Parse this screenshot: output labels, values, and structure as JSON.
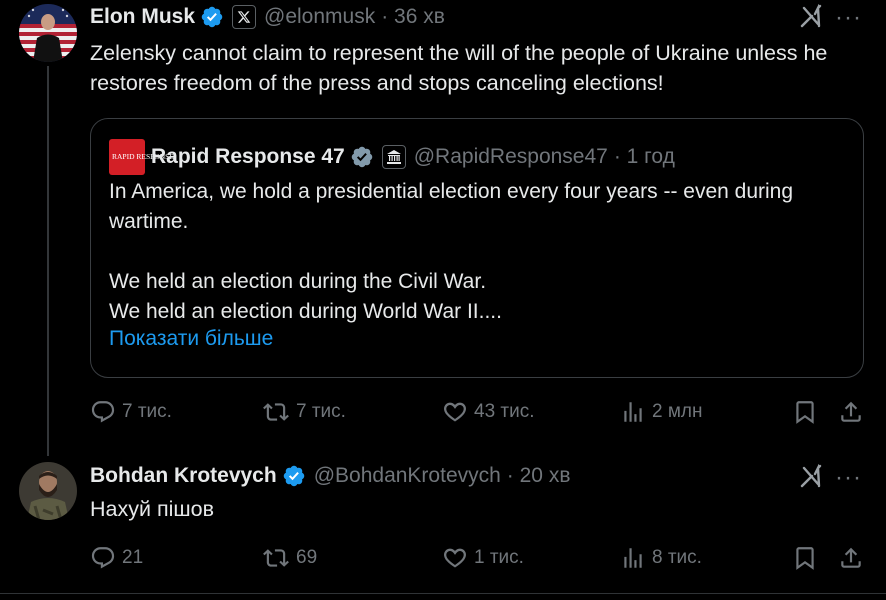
{
  "tweet1": {
    "name": "Elon Musk",
    "handle": "@elonmusk",
    "time": "· 36 хв",
    "text": "Zelensky cannot claim to represent the will of the people of Ukraine unless he restores freedom of the press and stops canceling elections!",
    "quote": {
      "avatar_text": "RAPID RESPONSE",
      "name": "Rapid Response 47",
      "handle": "@RapidResponse47",
      "time": "· 1 год",
      "text": "In America, we hold a presidential election every four years -- even during wartime.\n\nWe held an election during the Civil War.\nWe held an election during World War II....",
      "show_more": "Показати більше"
    },
    "actions": {
      "replies": "7 тис.",
      "reposts": "7 тис.",
      "likes": "43 тис.",
      "views": "2 млн"
    }
  },
  "tweet2": {
    "name": "Bohdan Krotevych",
    "handle": "@BohdanKrotevych",
    "time": "· 20 хв",
    "text": "Нахуй пішов",
    "actions": {
      "replies": "21",
      "reposts": "69",
      "likes": "1 тис.",
      "views": "8 тис."
    }
  },
  "colors": {
    "background": "#000000",
    "text": "#e7e9ea",
    "muted": "#71767b",
    "link": "#1d9bf0",
    "verified": "#1d9bf0"
  }
}
